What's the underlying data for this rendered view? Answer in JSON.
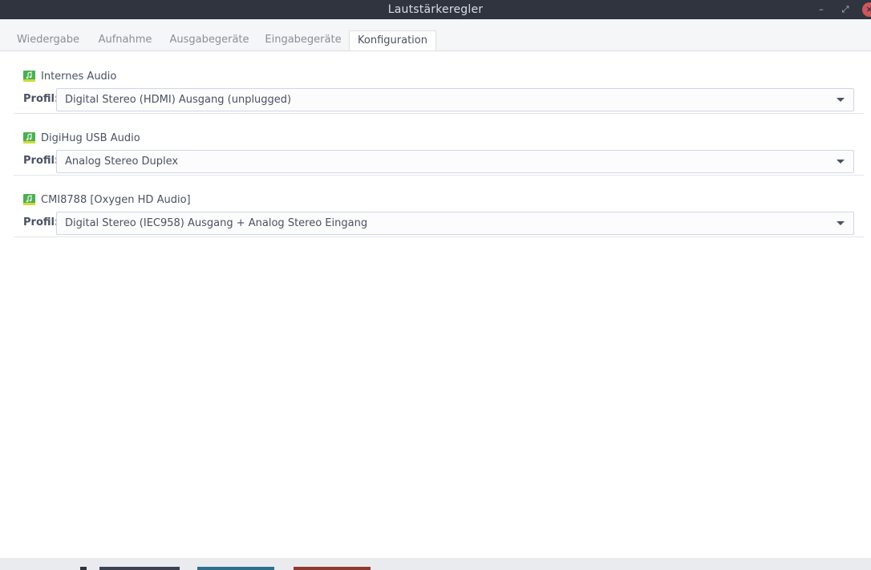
{
  "window": {
    "title": "Lautstärkeregler",
    "controls": {
      "minimize": "–",
      "maximize": "⤢",
      "close": "×"
    }
  },
  "tabs": [
    {
      "label": "Wiedergabe",
      "active": false
    },
    {
      "label": "Aufnahme",
      "active": false
    },
    {
      "label": "Ausgabegeräte",
      "active": false
    },
    {
      "label": "Eingabegeräte",
      "active": false
    },
    {
      "label": "Konfiguration",
      "active": true
    }
  ],
  "devices": [
    {
      "name": "Internes Audio",
      "profile_label": "Profil:",
      "profile_value": "Digital Stereo (HDMI) Ausgang (unplugged)",
      "icon": "audio-card-icon"
    },
    {
      "name": "DigiHug USB Audio",
      "profile_label": "Profil:",
      "profile_value": "Analog Stereo Duplex",
      "icon": "audio-card-icon"
    },
    {
      "name": "CMI8788 [Oxygen HD Audio]",
      "profile_label": "Profil:",
      "profile_value": "Digital Stereo (IEC958) Ausgang + Analog Stereo Eingang",
      "icon": "audio-card-icon"
    }
  ],
  "colors": {
    "titlebar": "#2f343f",
    "accent_icon": "#4caf50",
    "close_button": "#cc575d"
  }
}
